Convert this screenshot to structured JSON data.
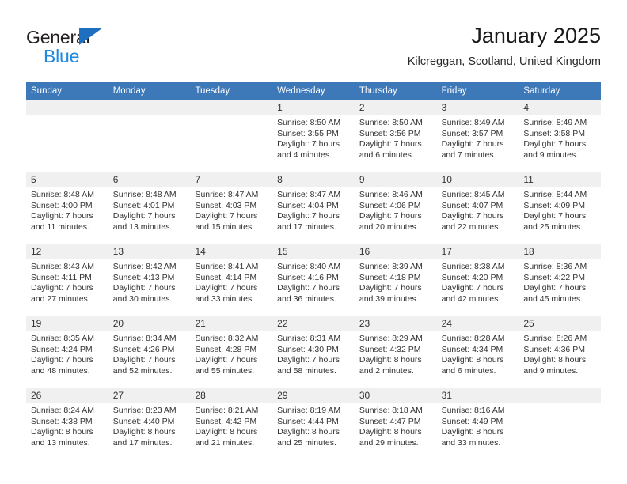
{
  "brand": {
    "name_part1": "General",
    "name_part2": "Blue",
    "triangle_icon": "triangle-logo-icon",
    "color_dark": "#231f20",
    "color_blue": "#1f8ae0",
    "color_triangle": "#1f6fc0"
  },
  "header": {
    "title": "January 2025",
    "subtitle": "Kilcreggan, Scotland, United Kingdom"
  },
  "theme": {
    "header_blue": "#3d78b9",
    "number_band": "#f0f0f0",
    "text": "#333333"
  },
  "weekdays": [
    "Sunday",
    "Monday",
    "Tuesday",
    "Wednesday",
    "Thursday",
    "Friday",
    "Saturday"
  ],
  "weeks": [
    {
      "days": [
        {
          "num": "",
          "sunrise": "",
          "sunset": "",
          "daylight_line1": "",
          "daylight_line2": "",
          "empty": true
        },
        {
          "num": "",
          "sunrise": "",
          "sunset": "",
          "daylight_line1": "",
          "daylight_line2": "",
          "empty": true
        },
        {
          "num": "",
          "sunrise": "",
          "sunset": "",
          "daylight_line1": "",
          "daylight_line2": "",
          "empty": true
        },
        {
          "num": "1",
          "sunrise": "Sunrise: 8:50 AM",
          "sunset": "Sunset: 3:55 PM",
          "daylight_line1": "Daylight: 7 hours",
          "daylight_line2": "and 4 minutes."
        },
        {
          "num": "2",
          "sunrise": "Sunrise: 8:50 AM",
          "sunset": "Sunset: 3:56 PM",
          "daylight_line1": "Daylight: 7 hours",
          "daylight_line2": "and 6 minutes."
        },
        {
          "num": "3",
          "sunrise": "Sunrise: 8:49 AM",
          "sunset": "Sunset: 3:57 PM",
          "daylight_line1": "Daylight: 7 hours",
          "daylight_line2": "and 7 minutes."
        },
        {
          "num": "4",
          "sunrise": "Sunrise: 8:49 AM",
          "sunset": "Sunset: 3:58 PM",
          "daylight_line1": "Daylight: 7 hours",
          "daylight_line2": "and 9 minutes."
        }
      ]
    },
    {
      "days": [
        {
          "num": "5",
          "sunrise": "Sunrise: 8:48 AM",
          "sunset": "Sunset: 4:00 PM",
          "daylight_line1": "Daylight: 7 hours",
          "daylight_line2": "and 11 minutes."
        },
        {
          "num": "6",
          "sunrise": "Sunrise: 8:48 AM",
          "sunset": "Sunset: 4:01 PM",
          "daylight_line1": "Daylight: 7 hours",
          "daylight_line2": "and 13 minutes."
        },
        {
          "num": "7",
          "sunrise": "Sunrise: 8:47 AM",
          "sunset": "Sunset: 4:03 PM",
          "daylight_line1": "Daylight: 7 hours",
          "daylight_line2": "and 15 minutes."
        },
        {
          "num": "8",
          "sunrise": "Sunrise: 8:47 AM",
          "sunset": "Sunset: 4:04 PM",
          "daylight_line1": "Daylight: 7 hours",
          "daylight_line2": "and 17 minutes."
        },
        {
          "num": "9",
          "sunrise": "Sunrise: 8:46 AM",
          "sunset": "Sunset: 4:06 PM",
          "daylight_line1": "Daylight: 7 hours",
          "daylight_line2": "and 20 minutes."
        },
        {
          "num": "10",
          "sunrise": "Sunrise: 8:45 AM",
          "sunset": "Sunset: 4:07 PM",
          "daylight_line1": "Daylight: 7 hours",
          "daylight_line2": "and 22 minutes."
        },
        {
          "num": "11",
          "sunrise": "Sunrise: 8:44 AM",
          "sunset": "Sunset: 4:09 PM",
          "daylight_line1": "Daylight: 7 hours",
          "daylight_line2": "and 25 minutes."
        }
      ]
    },
    {
      "days": [
        {
          "num": "12",
          "sunrise": "Sunrise: 8:43 AM",
          "sunset": "Sunset: 4:11 PM",
          "daylight_line1": "Daylight: 7 hours",
          "daylight_line2": "and 27 minutes."
        },
        {
          "num": "13",
          "sunrise": "Sunrise: 8:42 AM",
          "sunset": "Sunset: 4:13 PM",
          "daylight_line1": "Daylight: 7 hours",
          "daylight_line2": "and 30 minutes."
        },
        {
          "num": "14",
          "sunrise": "Sunrise: 8:41 AM",
          "sunset": "Sunset: 4:14 PM",
          "daylight_line1": "Daylight: 7 hours",
          "daylight_line2": "and 33 minutes."
        },
        {
          "num": "15",
          "sunrise": "Sunrise: 8:40 AM",
          "sunset": "Sunset: 4:16 PM",
          "daylight_line1": "Daylight: 7 hours",
          "daylight_line2": "and 36 minutes."
        },
        {
          "num": "16",
          "sunrise": "Sunrise: 8:39 AM",
          "sunset": "Sunset: 4:18 PM",
          "daylight_line1": "Daylight: 7 hours",
          "daylight_line2": "and 39 minutes."
        },
        {
          "num": "17",
          "sunrise": "Sunrise: 8:38 AM",
          "sunset": "Sunset: 4:20 PM",
          "daylight_line1": "Daylight: 7 hours",
          "daylight_line2": "and 42 minutes."
        },
        {
          "num": "18",
          "sunrise": "Sunrise: 8:36 AM",
          "sunset": "Sunset: 4:22 PM",
          "daylight_line1": "Daylight: 7 hours",
          "daylight_line2": "and 45 minutes."
        }
      ]
    },
    {
      "days": [
        {
          "num": "19",
          "sunrise": "Sunrise: 8:35 AM",
          "sunset": "Sunset: 4:24 PM",
          "daylight_line1": "Daylight: 7 hours",
          "daylight_line2": "and 48 minutes."
        },
        {
          "num": "20",
          "sunrise": "Sunrise: 8:34 AM",
          "sunset": "Sunset: 4:26 PM",
          "daylight_line1": "Daylight: 7 hours",
          "daylight_line2": "and 52 minutes."
        },
        {
          "num": "21",
          "sunrise": "Sunrise: 8:32 AM",
          "sunset": "Sunset: 4:28 PM",
          "daylight_line1": "Daylight: 7 hours",
          "daylight_line2": "and 55 minutes."
        },
        {
          "num": "22",
          "sunrise": "Sunrise: 8:31 AM",
          "sunset": "Sunset: 4:30 PM",
          "daylight_line1": "Daylight: 7 hours",
          "daylight_line2": "and 58 minutes."
        },
        {
          "num": "23",
          "sunrise": "Sunrise: 8:29 AM",
          "sunset": "Sunset: 4:32 PM",
          "daylight_line1": "Daylight: 8 hours",
          "daylight_line2": "and 2 minutes."
        },
        {
          "num": "24",
          "sunrise": "Sunrise: 8:28 AM",
          "sunset": "Sunset: 4:34 PM",
          "daylight_line1": "Daylight: 8 hours",
          "daylight_line2": "and 6 minutes."
        },
        {
          "num": "25",
          "sunrise": "Sunrise: 8:26 AM",
          "sunset": "Sunset: 4:36 PM",
          "daylight_line1": "Daylight: 8 hours",
          "daylight_line2": "and 9 minutes."
        }
      ]
    },
    {
      "days": [
        {
          "num": "26",
          "sunrise": "Sunrise: 8:24 AM",
          "sunset": "Sunset: 4:38 PM",
          "daylight_line1": "Daylight: 8 hours",
          "daylight_line2": "and 13 minutes."
        },
        {
          "num": "27",
          "sunrise": "Sunrise: 8:23 AM",
          "sunset": "Sunset: 4:40 PM",
          "daylight_line1": "Daylight: 8 hours",
          "daylight_line2": "and 17 minutes."
        },
        {
          "num": "28",
          "sunrise": "Sunrise: 8:21 AM",
          "sunset": "Sunset: 4:42 PM",
          "daylight_line1": "Daylight: 8 hours",
          "daylight_line2": "and 21 minutes."
        },
        {
          "num": "29",
          "sunrise": "Sunrise: 8:19 AM",
          "sunset": "Sunset: 4:44 PM",
          "daylight_line1": "Daylight: 8 hours",
          "daylight_line2": "and 25 minutes."
        },
        {
          "num": "30",
          "sunrise": "Sunrise: 8:18 AM",
          "sunset": "Sunset: 4:47 PM",
          "daylight_line1": "Daylight: 8 hours",
          "daylight_line2": "and 29 minutes."
        },
        {
          "num": "31",
          "sunrise": "Sunrise: 8:16 AM",
          "sunset": "Sunset: 4:49 PM",
          "daylight_line1": "Daylight: 8 hours",
          "daylight_line2": "and 33 minutes."
        },
        {
          "num": "",
          "sunrise": "",
          "sunset": "",
          "daylight_line1": "",
          "daylight_line2": "",
          "empty": true
        }
      ]
    }
  ]
}
